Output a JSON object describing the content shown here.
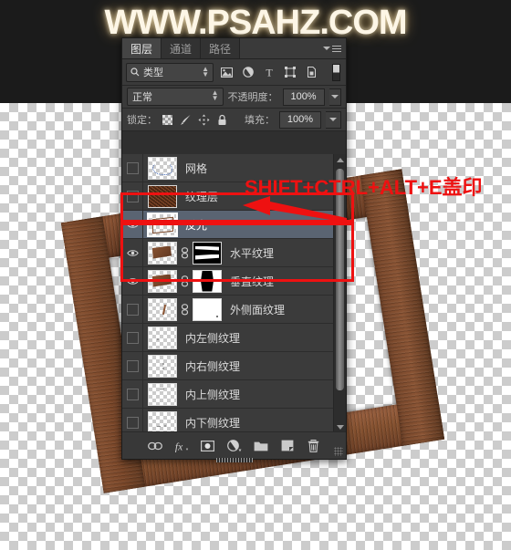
{
  "watermark": {
    "text": "WWW.PSAHZ.COM"
  },
  "canvas": {
    "background": "transparent-checkerboard",
    "artwork": "wooden-picture-frame"
  },
  "colors": {
    "panel_bg": "#2f2f2f",
    "row_bg": "#3b3b3b",
    "selected_row": "#5a6472",
    "annotation_red": "#ee1111",
    "wood_brown": "#7d4a2d",
    "text": "#dcdcdc"
  },
  "panel": {
    "tabs": [
      {
        "label": "图层",
        "active": true,
        "name": "tab-layers"
      },
      {
        "label": "通道",
        "active": false,
        "name": "tab-channels"
      },
      {
        "label": "路径",
        "active": false,
        "name": "tab-paths"
      }
    ],
    "menu_icon": "panel-menu-icon",
    "filter": {
      "kind_label": "类型",
      "search_icon": "search-icon",
      "icons": [
        {
          "name": "pixel-layer-filter-icon"
        },
        {
          "name": "adjustment-layer-filter-icon"
        },
        {
          "name": "type-layer-filter-icon"
        },
        {
          "name": "shape-layer-filter-icon"
        },
        {
          "name": "smart-object-filter-icon"
        }
      ],
      "toggle_name": "filter-enable-toggle"
    },
    "blend": {
      "mode": "正常",
      "opacity_label": "不透明度：",
      "opacity_value": "100%"
    },
    "lock": {
      "label": "锁定：",
      "icons": [
        {
          "name": "lock-transparent-pixels-icon"
        },
        {
          "name": "lock-image-pixels-icon"
        },
        {
          "name": "lock-position-icon"
        },
        {
          "name": "lock-all-icon"
        }
      ],
      "fill_label": "填充：",
      "fill_value": "100%"
    },
    "layers": [
      {
        "name": "网格",
        "visible": false,
        "selected": false,
        "thumb": "grid",
        "mask": null,
        "linked": false
      },
      {
        "name": "纹理层",
        "visible": false,
        "selected": false,
        "thumb": "noise",
        "mask": null,
        "linked": false
      },
      {
        "name": "反光",
        "visible": true,
        "selected": true,
        "thumb": "outline",
        "mask": null,
        "linked": false
      },
      {
        "name": "水平纹理",
        "visible": true,
        "selected": false,
        "thumb": "wood",
        "mask": "h-bands",
        "linked": true
      },
      {
        "name": "垂直纹理",
        "visible": true,
        "selected": false,
        "thumb": "wood",
        "mask": "v-band",
        "linked": true
      },
      {
        "name": "外侧面纹理",
        "visible": false,
        "selected": false,
        "thumb": "sparse",
        "mask": "white",
        "linked": true
      },
      {
        "name": "内左侧纹理",
        "visible": false,
        "selected": false,
        "thumb": "sparse",
        "mask": null,
        "linked": false
      },
      {
        "name": "内右侧纹理",
        "visible": false,
        "selected": false,
        "thumb": "sparse",
        "mask": null,
        "linked": false
      },
      {
        "name": "内上侧纹理",
        "visible": false,
        "selected": false,
        "thumb": "sparse",
        "mask": null,
        "linked": false
      },
      {
        "name": "内下侧纹理",
        "visible": false,
        "selected": false,
        "thumb": "sparse",
        "mask": null,
        "linked": false
      }
    ],
    "scrollbar": {
      "up": "scroll-up-arrow-icon",
      "down": "scroll-down-arrow-icon"
    },
    "footer_buttons": [
      {
        "name": "link-layers-button",
        "glyph": "link"
      },
      {
        "name": "layer-style-button",
        "glyph": "fx"
      },
      {
        "name": "add-layer-mask-button",
        "glyph": "mask"
      },
      {
        "name": "adjustment-layer-button",
        "glyph": "adjust"
      },
      {
        "name": "new-group-button",
        "glyph": "folder"
      },
      {
        "name": "new-layer-button",
        "glyph": "newlayer"
      },
      {
        "name": "delete-layer-button",
        "glyph": "trash"
      }
    ]
  },
  "annotations": {
    "shortcut_text": "SHIFT+CTRL+ALT+E盖印",
    "boxes": [
      {
        "name": "highlight-box-fanguang",
        "target": "反光"
      },
      {
        "name": "highlight-box-textures",
        "target": "水平纹理 / 垂直纹理"
      }
    ],
    "arrow": {
      "name": "annotation-arrow",
      "points_to": "反光"
    }
  }
}
